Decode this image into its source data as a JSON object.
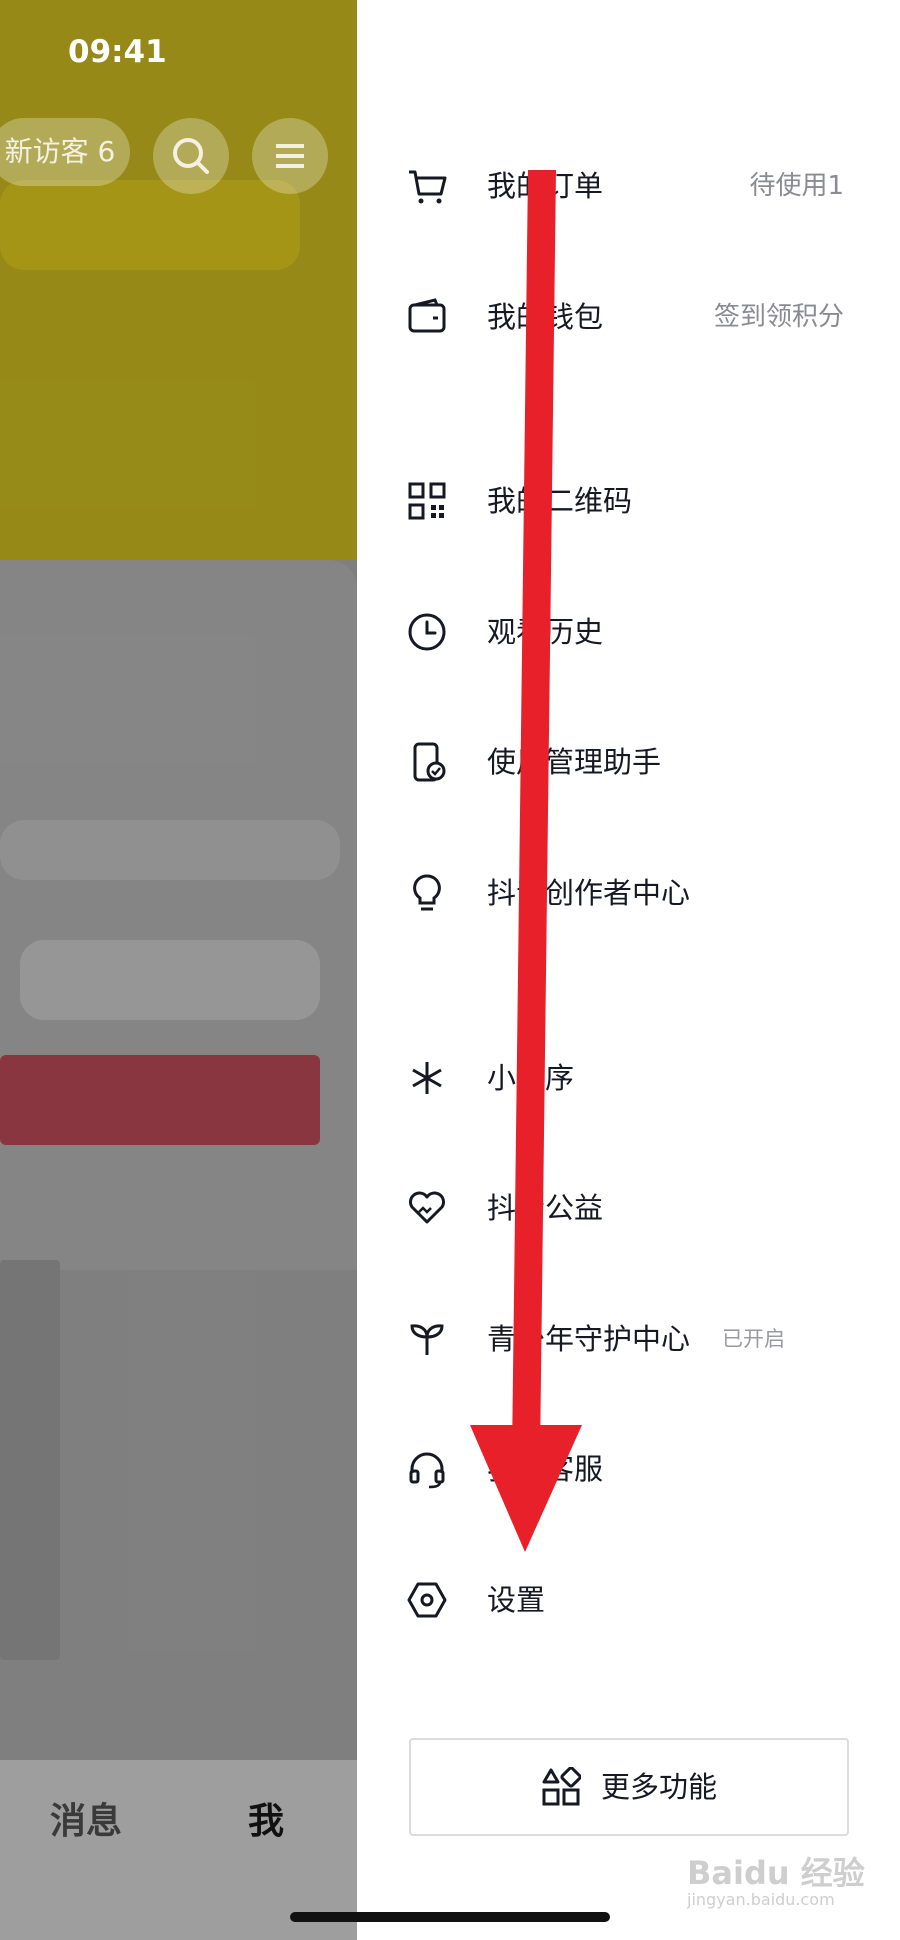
{
  "status_bar": {
    "time": "09:41"
  },
  "background_app": {
    "visitors_label": "新访客 6",
    "tabs": [
      {
        "label": "消息"
      },
      {
        "label": "我"
      }
    ]
  },
  "drawer": {
    "items": [
      {
        "label": "我的订单",
        "meta": "待使用1",
        "icon": "cart-icon"
      },
      {
        "label": "我的钱包",
        "meta": "签到领积分",
        "icon": "wallet-icon"
      },
      {
        "label": "我的二维码",
        "icon": "qr-code-icon"
      },
      {
        "label": "观看历史",
        "icon": "clock-icon"
      },
      {
        "label": "使用管理助手",
        "icon": "phone-check-icon"
      },
      {
        "label": "抖音创作者中心",
        "icon": "lightbulb-icon"
      },
      {
        "label": "小程序",
        "icon": "mini-program-icon"
      },
      {
        "label": "抖音公益",
        "icon": "charity-heart-icon"
      },
      {
        "label": "青少年守护中心",
        "tag": "已开启",
        "icon": "sprout-icon"
      },
      {
        "label": "我的客服",
        "icon": "headset-icon"
      },
      {
        "label": "设置",
        "icon": "settings-hexagon-icon"
      }
    ],
    "more_button": {
      "label": "更多功能",
      "icon": "grid-shapes-icon"
    }
  },
  "watermark": {
    "text": "Baidu 经验",
    "sub": "jingyan.baidu.com"
  },
  "annotation": {
    "arrow_color": "#e8202a",
    "direction": "down"
  }
}
